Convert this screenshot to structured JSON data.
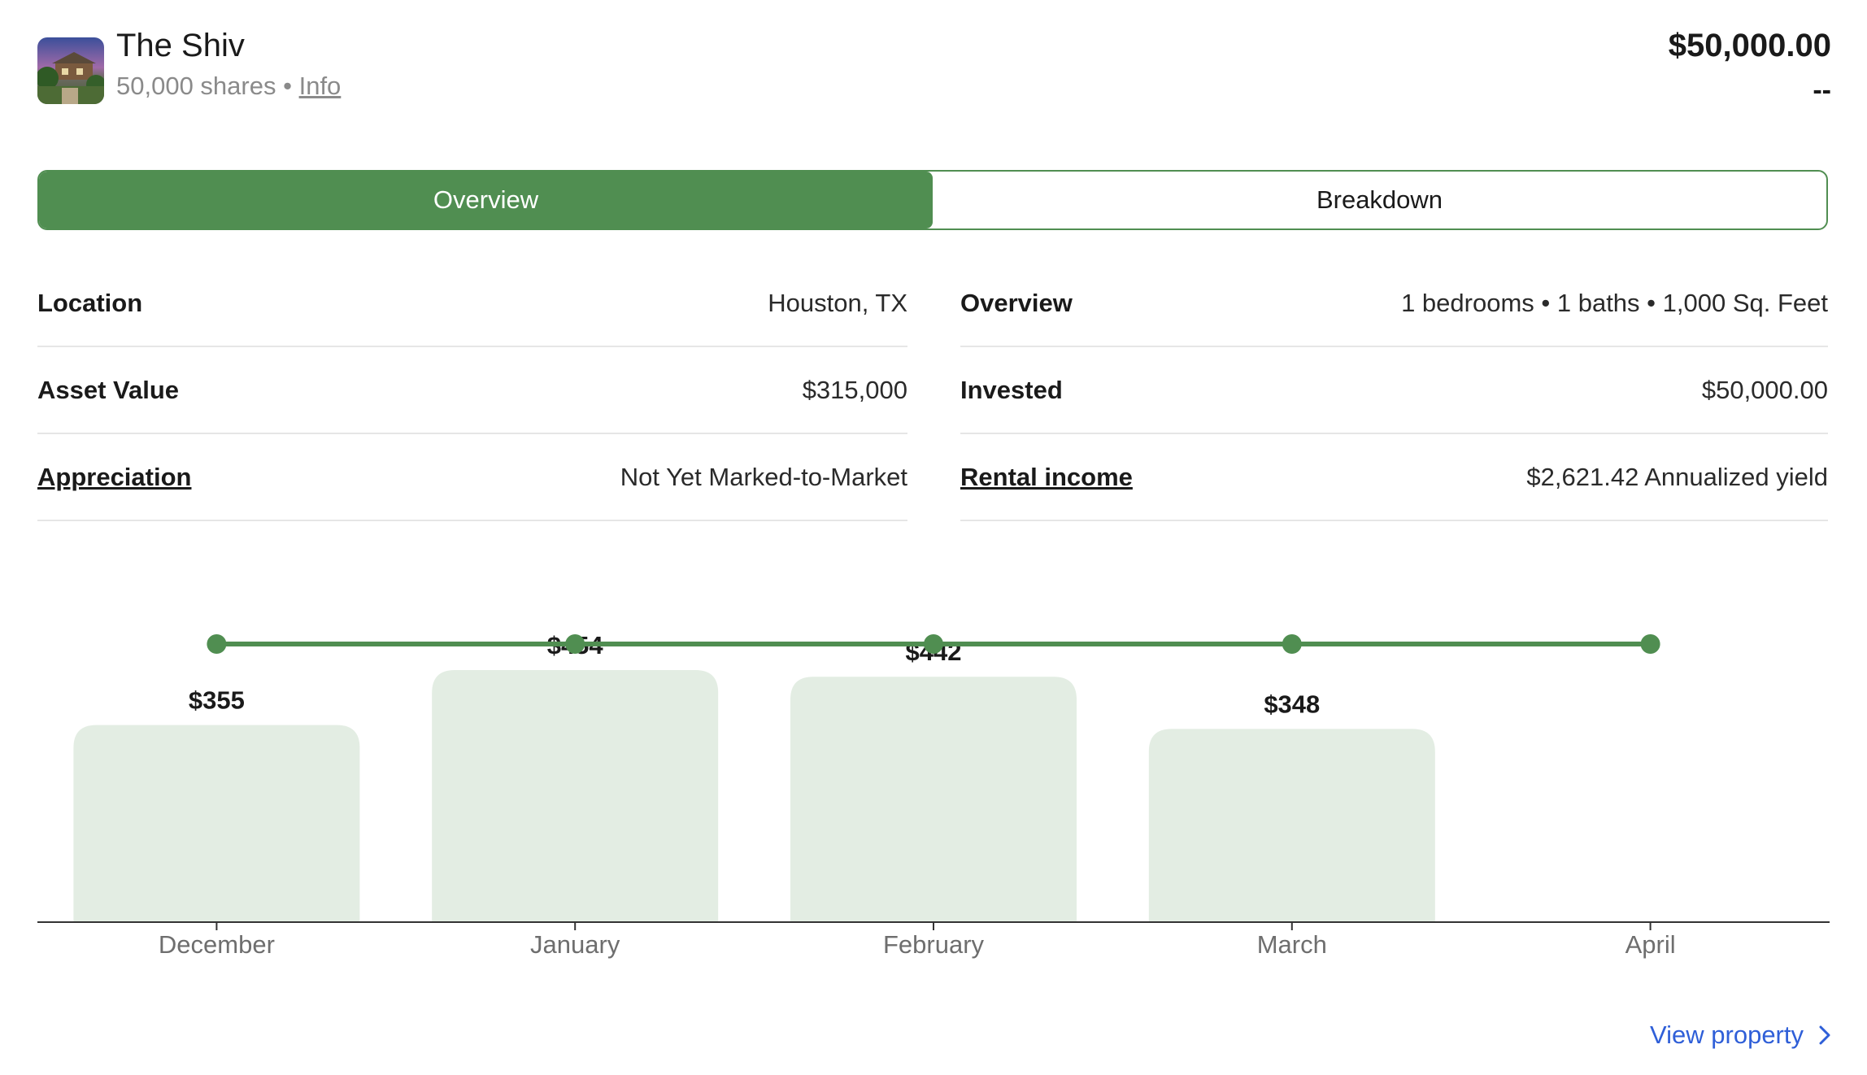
{
  "header": {
    "title": "The Shiv",
    "shares": "50,000 shares",
    "separator": "•",
    "info_link": "Info",
    "amount": "$50,000.00",
    "change": "--"
  },
  "tabs": [
    {
      "label": "Overview",
      "active": true
    },
    {
      "label": "Breakdown",
      "active": false
    }
  ],
  "details_left": [
    {
      "label": "Location",
      "value": "Houston, TX",
      "link": false
    },
    {
      "label": "Asset Value",
      "value": "$315,000",
      "link": false
    },
    {
      "label": "Appreciation",
      "value": "Not Yet Marked-to-Market",
      "link": true
    }
  ],
  "details_right": [
    {
      "label": "Overview",
      "value": "1 bedrooms • 1 baths • 1,000 Sq. Feet",
      "link": false
    },
    {
      "label": "Invested",
      "value": "$50,000.00",
      "link": false
    },
    {
      "label": "Rental income",
      "value": "$2,621.42 Annualized yield",
      "link": true
    }
  ],
  "colors": {
    "accent": "#508e51",
    "bar_fill": "#e3ede3",
    "link": "#2f5fd8"
  },
  "chart_data": {
    "type": "bar",
    "categories": [
      "December",
      "January",
      "February",
      "March",
      "April"
    ],
    "values": [
      355,
      454,
      442,
      348,
      null
    ],
    "value_labels": [
      "$355",
      "$454",
      "$442",
      "$348",
      ""
    ],
    "line_values": [
      1,
      1,
      1,
      1,
      1
    ]
  },
  "footer": {
    "view_property": "View property",
    "chevron_icon": "chevron-right-icon"
  }
}
